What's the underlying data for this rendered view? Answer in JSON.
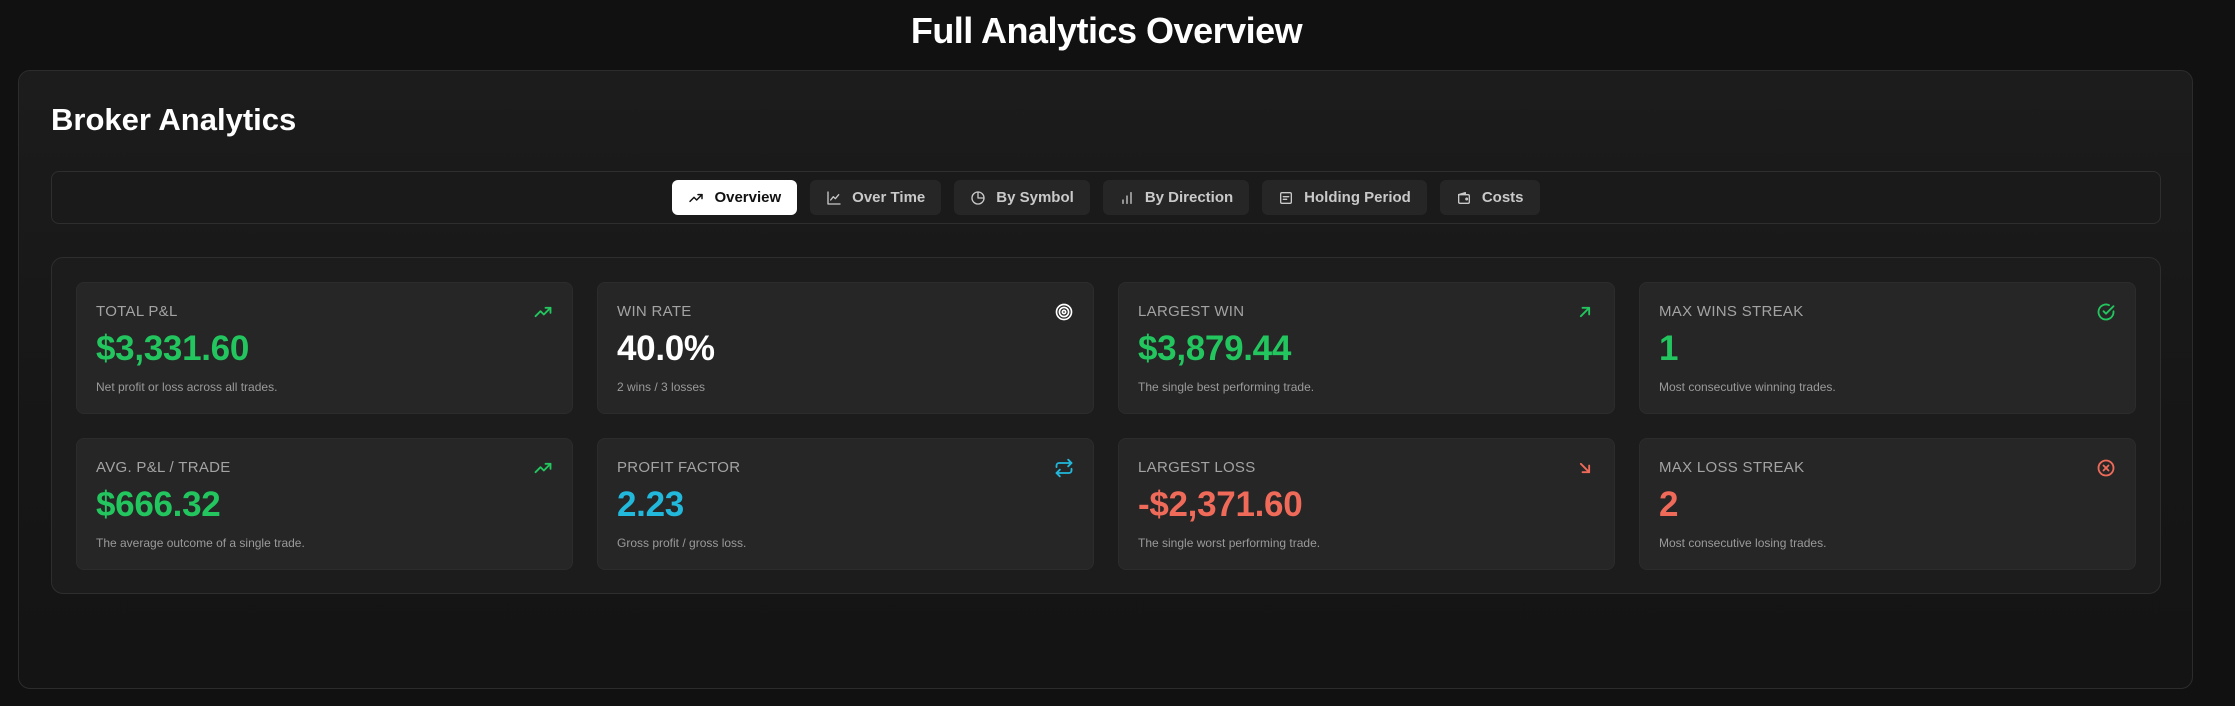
{
  "page": {
    "title": "Full Analytics Overview"
  },
  "panel": {
    "title": "Broker Analytics"
  },
  "tabs": [
    {
      "label": "Overview",
      "icon": "trending-up-icon",
      "active": true
    },
    {
      "label": "Over Time",
      "icon": "line-chart-icon",
      "active": false
    },
    {
      "label": "By Symbol",
      "icon": "pie-chart-icon",
      "active": false
    },
    {
      "label": "By Direction",
      "icon": "bar-chart-icon",
      "active": false
    },
    {
      "label": "Holding Period",
      "icon": "calendar-icon",
      "active": false
    },
    {
      "label": "Costs",
      "icon": "wallet-icon",
      "active": false
    }
  ],
  "cards": [
    {
      "label": "Total P&L",
      "value": "$3,331.60",
      "description": "Net profit or loss across all trades.",
      "icon": "trending-up-icon",
      "color": "#22c55e"
    },
    {
      "label": "Win Rate",
      "value": "40.0%",
      "description": "2 wins / 3 losses",
      "icon": "target-icon",
      "color": "#ffffff"
    },
    {
      "label": "Largest Win",
      "value": "$3,879.44",
      "description": "The single best performing trade.",
      "icon": "arrow-up-right-icon",
      "color": "#22c55e"
    },
    {
      "label": "Max Wins Streak",
      "value": "1",
      "description": "Most consecutive winning trades.",
      "icon": "check-circle-icon",
      "color": "#22c55e"
    },
    {
      "label": "Avg. P&L / Trade",
      "value": "$666.32",
      "description": "The average outcome of a single trade.",
      "icon": "trending-up-icon",
      "color": "#22c55e"
    },
    {
      "label": "Profit Factor",
      "value": "2.23",
      "description": "Gross profit / gross loss.",
      "icon": "repeat-icon",
      "color": "#22b8dc"
    },
    {
      "label": "Largest Loss",
      "value": "-$2,371.60",
      "description": "The single worst performing trade.",
      "icon": "arrow-down-right-icon",
      "color": "#f06a5a"
    },
    {
      "label": "Max Loss Streak",
      "value": "2",
      "description": "Most consecutive losing trades.",
      "icon": "x-circle-icon",
      "color": "#f06a5a"
    }
  ]
}
